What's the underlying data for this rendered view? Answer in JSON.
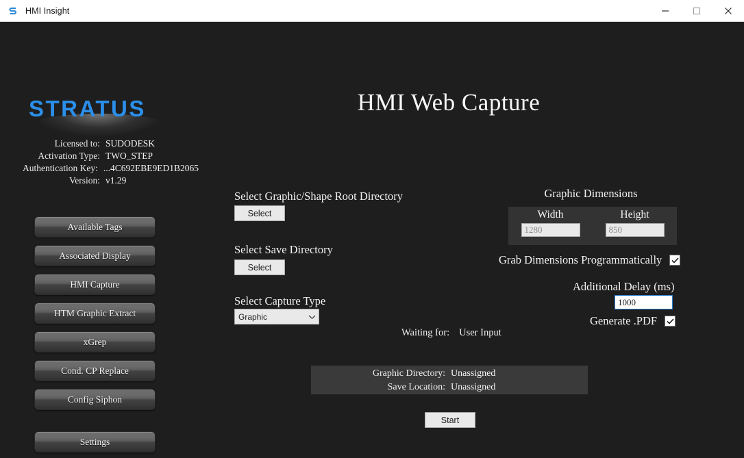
{
  "window": {
    "title": "HMI Insight",
    "icon": "stratus-s-icon",
    "controls": {
      "minimize": "minimize-icon",
      "maximize": "maximize-icon",
      "close": "close-icon"
    }
  },
  "brand": {
    "logo_text": "STRATUS",
    "logo_color": "#2b8fea"
  },
  "license": {
    "rows": [
      {
        "label": "Licensed to:",
        "value": "SUDODESK"
      },
      {
        "label": "Activation Type:",
        "value": "TWO_STEP"
      },
      {
        "label": "Authentication Key:",
        "value": "...4C692EBE9ED1B2065"
      },
      {
        "label": "Version:",
        "value": "v1.29"
      }
    ]
  },
  "sidebar": {
    "items": [
      {
        "label": "Available Tags"
      },
      {
        "label": "Associated Display"
      },
      {
        "label": "HMI Capture"
      },
      {
        "label": "HTM Graphic Extract"
      },
      {
        "label": "xGrep"
      },
      {
        "label": "Cond. CP Replace"
      },
      {
        "label": "Config Siphon"
      }
    ],
    "settings_label": "Settings"
  },
  "main": {
    "title": "HMI Web Capture",
    "graphic_root": {
      "label": "Select Graphic/Shape Root Directory",
      "button": "Select"
    },
    "save_directory": {
      "label": "Select Save Directory",
      "button": "Select"
    },
    "capture_type": {
      "label": "Select Capture Type",
      "value": "Graphic",
      "arrow_icon": "chevron-down-icon",
      "options": [
        "Graphic"
      ]
    },
    "waiting": {
      "label": "Waiting for:",
      "value": "User Input"
    },
    "start_button": "Start"
  },
  "dimensions": {
    "title": "Graphic Dimensions",
    "width": {
      "label": "Width",
      "placeholder": "1280",
      "value": ""
    },
    "height": {
      "label": "Height",
      "placeholder": "850",
      "value": ""
    }
  },
  "options": {
    "grab_dimensions": {
      "label": "Grab Dimensions Programmatically",
      "checked": "✔"
    },
    "additional_delay": {
      "label": "Additional Delay (ms)",
      "value": "1000"
    },
    "generate_pdf": {
      "label": "Generate .PDF",
      "checked": "✔"
    }
  },
  "status": {
    "rows": [
      {
        "label": "Graphic Directory:",
        "value": "Unassigned"
      },
      {
        "label": "Save Location:",
        "value": "Unassigned"
      }
    ]
  }
}
